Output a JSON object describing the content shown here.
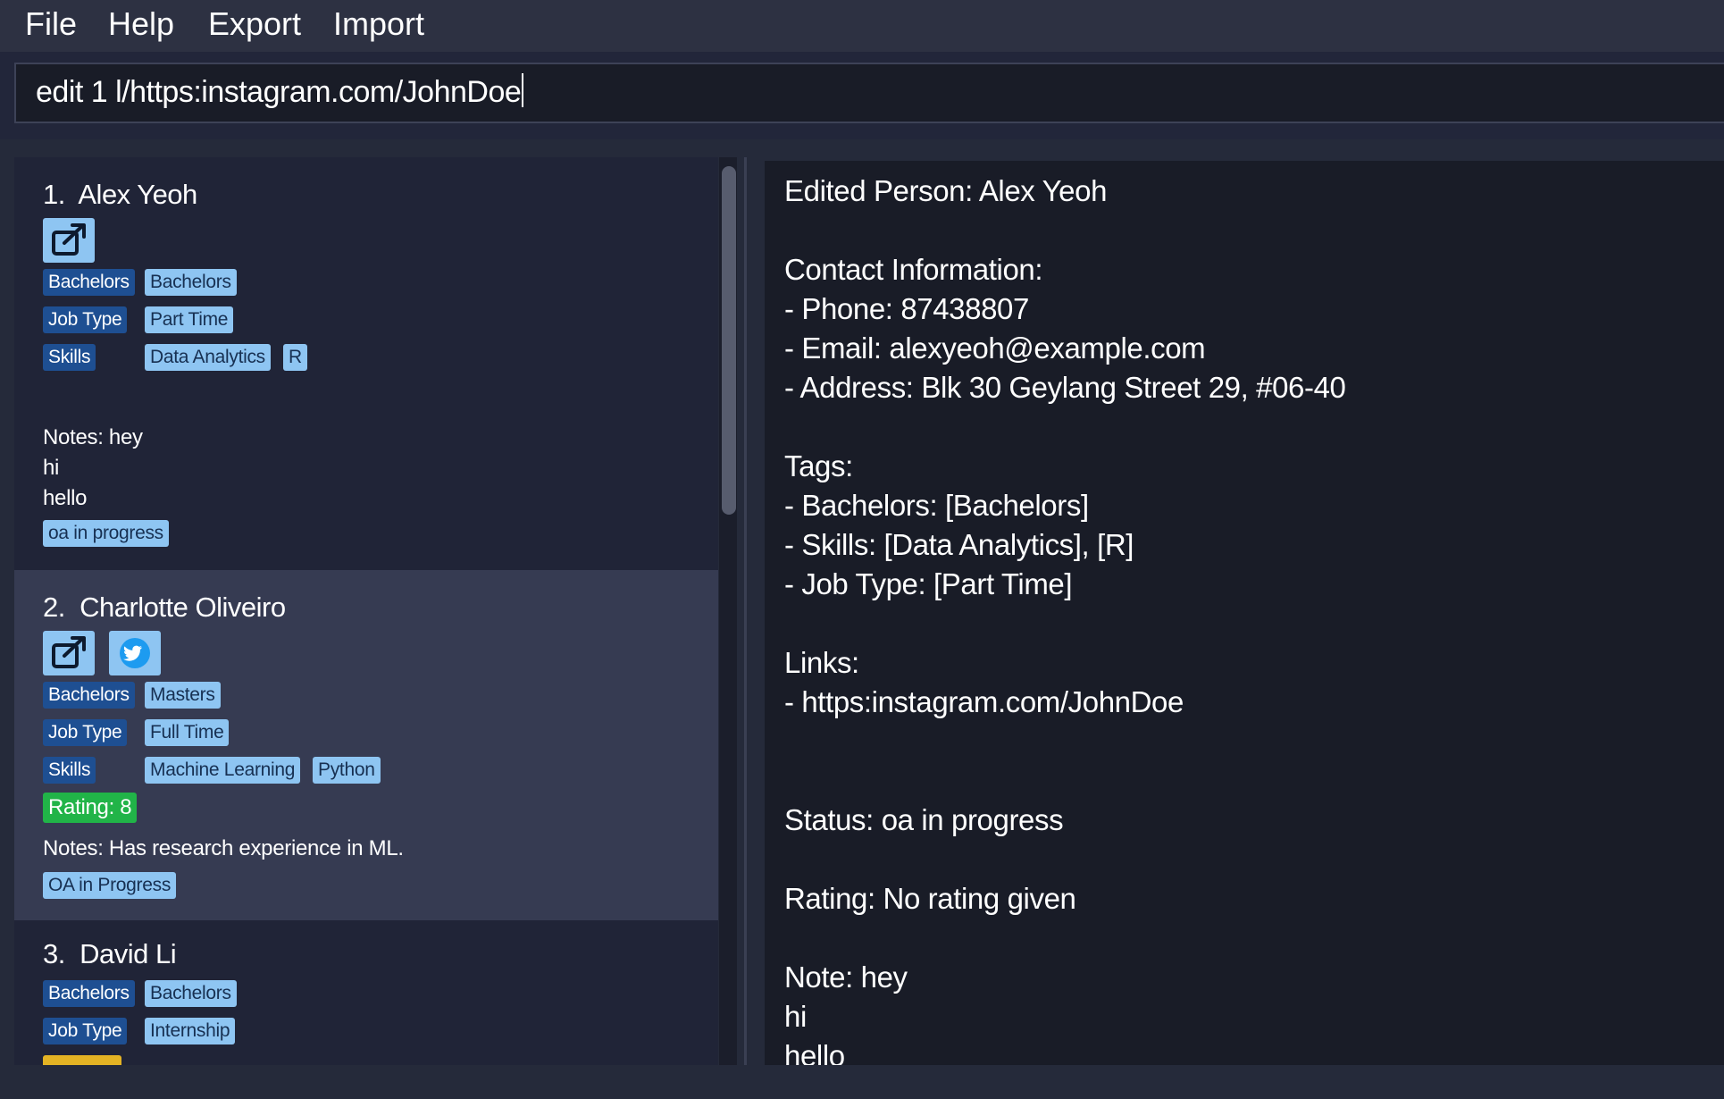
{
  "menu": {
    "file": "File",
    "help": "Help",
    "export": "Export",
    "import": "Import"
  },
  "command": {
    "value": "edit 1 l/https:instagram.com/JohnDoe"
  },
  "persons": [
    {
      "index": "1.",
      "name": "Alex Yeoh",
      "tags": {
        "degree_label": "Bachelors",
        "degree_value": "Bachelors",
        "jobtype_label": "Job Type",
        "jobtype_value": "Part Time",
        "skills_label": "Skills",
        "skill_1": "Data Analytics",
        "skill_2": "R"
      },
      "notes": [
        "Notes: hey",
        "hi",
        "hello"
      ],
      "status": "oa in progress"
    },
    {
      "index": "2.",
      "name": "Charlotte Oliveiro",
      "tags": {
        "degree_label": "Bachelors",
        "degree_value": "Masters",
        "jobtype_label": "Job Type",
        "jobtype_value": "Full Time",
        "skills_label": "Skills",
        "skill_1": "Machine Learning",
        "skill_2": "Python"
      },
      "rating": "Rating: 8",
      "notes": [
        "Notes: Has research experience in ML."
      ],
      "status": "OA in Progress"
    },
    {
      "index": "3.",
      "name": "David Li",
      "tags": {
        "degree_label": "Bachelors",
        "degree_value": "Bachelors",
        "jobtype_label": "Job Type",
        "jobtype_value": "Internship"
      }
    }
  ],
  "detail": {
    "text": "Edited Person: Alex Yeoh\n\nContact Information:\n- Phone: 87438807\n- Email: alexyeoh@example.com\n- Address: Blk 30 Geylang Street 29, #06-40\n\nTags:\n- Bachelors: [Bachelors]\n- Skills: [Data Analytics], [R]\n- Job Type: [Part Time]\n\nLinks:\n- https:instagram.com/JohnDoe\n\n\nStatus: oa in progress\n\nRating: No rating given\n\nNote: hey\nhi\nhello"
  },
  "colors": {
    "tag_dark": "#1e4f92",
    "tag_light": "#8ec5f2",
    "rating_green": "#21b448",
    "rating_gold": "#e4b324",
    "selected_card": "#363b52"
  },
  "icons": [
    "external-link-icon",
    "twitter-icon"
  ]
}
